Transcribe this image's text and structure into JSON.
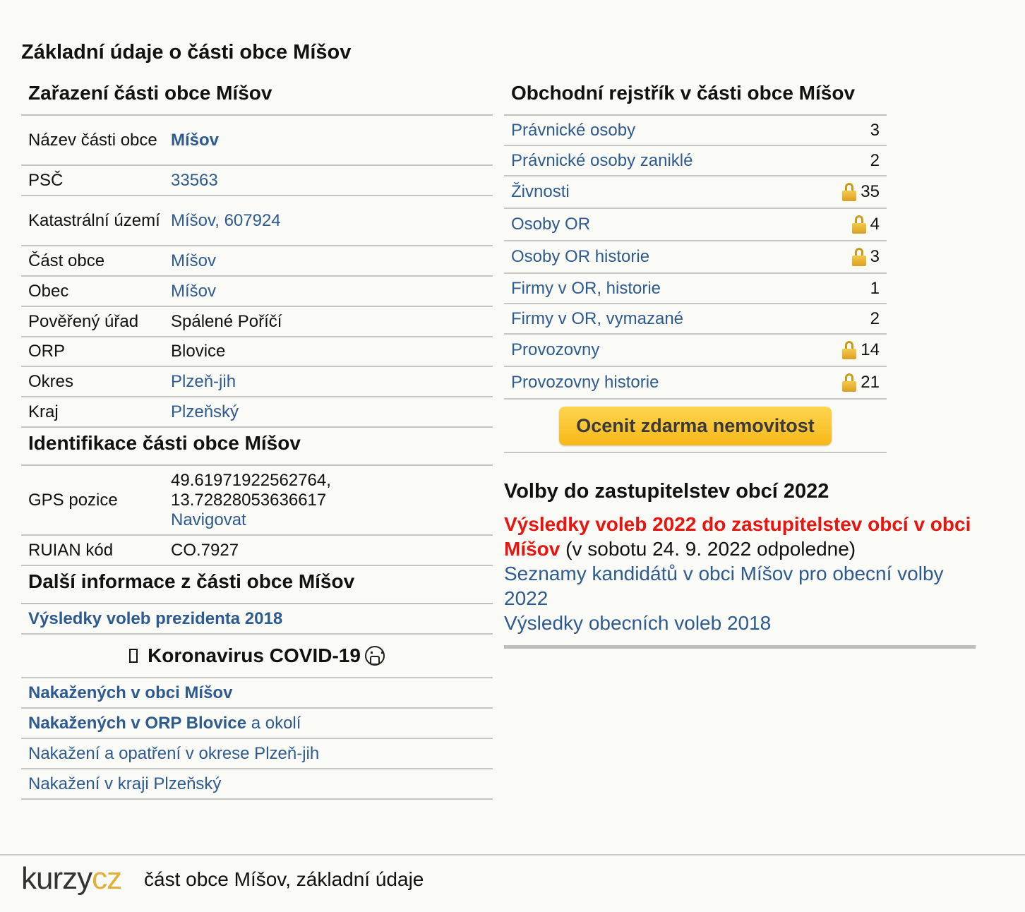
{
  "page_title": "Základní údaje o části obce Míšov",
  "zarazeni": {
    "heading": "Zařazení části obce Míšov",
    "rows": [
      {
        "label": "Název části obce",
        "value": "Míšov"
      },
      {
        "label": "PSČ",
        "value": "33563"
      },
      {
        "label": "Katastrální území",
        "value": "Míšov, 607924"
      },
      {
        "label": "Část obce",
        "value": "Míšov"
      },
      {
        "label": "Obec",
        "value": "Míšov"
      },
      {
        "label": "Pověřený úřad",
        "value": "Spálené Poříčí"
      },
      {
        "label": "ORP",
        "value": "Blovice"
      },
      {
        "label": "Okres",
        "value": "Plzeň-jih"
      },
      {
        "label": "Kraj",
        "value": "Plzeňský"
      }
    ]
  },
  "identifikace": {
    "heading": "Identifikace části obce Míšov",
    "gps_label": "GPS pozice",
    "gps_lat": "49.61971922562764,",
    "gps_lon": "13.72828053636617",
    "navigate": "Navigovat",
    "ruian_label": "RUIAN kód",
    "ruian_value": "CO.7927"
  },
  "dalsi": {
    "heading": "Další informace z části obce Míšov",
    "link_prezident": "Výsledky voleb prezidenta 2018"
  },
  "covid": {
    "title": "Koronavirus COVID-19",
    "link1": "Nakažených v obci Míšov",
    "link2_bold": "Nakažených v ORP Blovice",
    "link2_rest": " a okolí",
    "link3": "Nakažení a opatření v okrese Plzeň-jih",
    "link4": "Nakažení v kraji Plzeňský"
  },
  "rejstrik": {
    "heading": "Obchodní rejstřík v části obce Míšov",
    "rows": [
      {
        "label": "Právnické osoby",
        "count": "3"
      },
      {
        "label": "Právnické osoby zaniklé",
        "count": "2"
      },
      {
        "label": "Živnosti",
        "count": "35"
      },
      {
        "label": "Osoby OR",
        "count": "4"
      },
      {
        "label": "Osoby OR historie",
        "count": "3"
      },
      {
        "label": "Firmy v OR, historie",
        "count": "1"
      },
      {
        "label": "Firmy v OR, vymazané",
        "count": "2"
      },
      {
        "label": "Provozovny",
        "count": "14"
      },
      {
        "label": "Provozovny historie",
        "count": "21"
      }
    ],
    "button": "Ocenit zdarma nemovitost"
  },
  "volby": {
    "heading": "Volby do zastupitelstev obcí 2022",
    "result_link": "Výsledky voleb 2022 do zastupitelstev obcí v obci Míšov",
    "result_note": " (v sobotu 24. 9. 2022 odpoledne)",
    "kandidati": "Seznamy kandidátů v obci Míšov pro obecní volby 2022",
    "vysledky2018": "Výsledky obecních voleb 2018"
  },
  "footer": {
    "logo_a": "kurzy",
    "logo_b": "cz",
    "text": "část obce Míšov, základní údaje"
  }
}
